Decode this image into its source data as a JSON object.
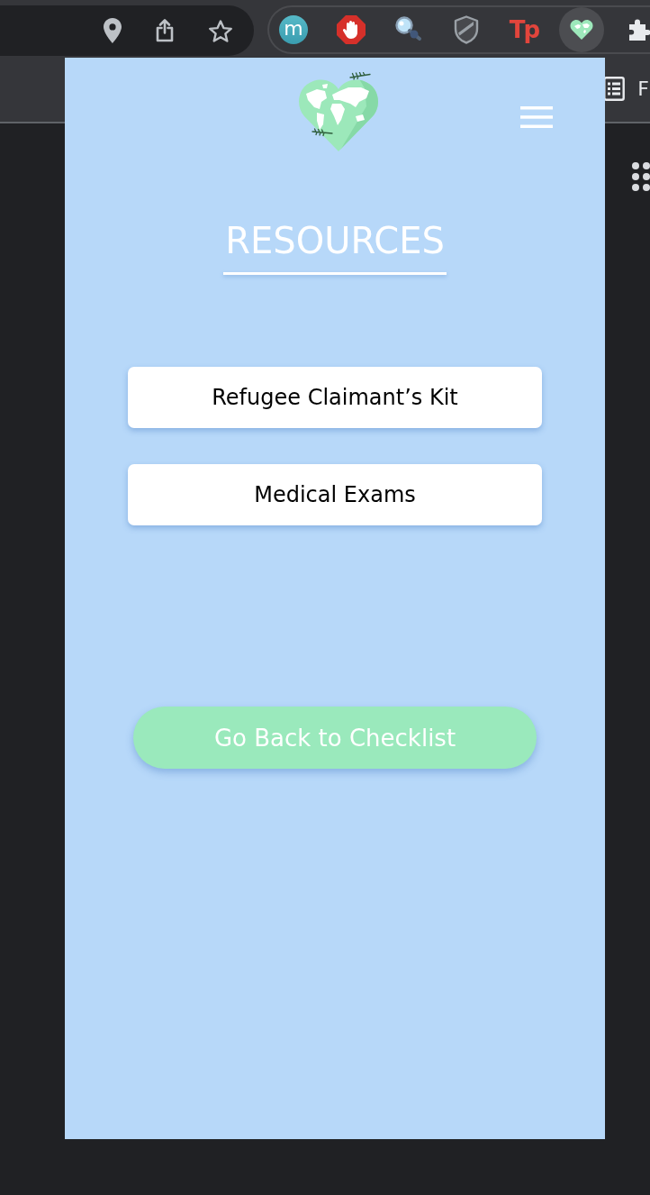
{
  "browser_toolbar": {
    "extensions": [
      {
        "kind": "letter",
        "text": "m",
        "selected": false
      },
      {
        "kind": "stop-hand",
        "selected": false
      },
      {
        "kind": "magnifier",
        "selected": false
      },
      {
        "kind": "shield",
        "selected": false
      },
      {
        "kind": "wordmark",
        "text": "Tp",
        "selected": false
      },
      {
        "kind": "heart",
        "selected": true
      },
      {
        "kind": "puzzle",
        "selected": false
      }
    ]
  },
  "side_button": {
    "label": "F"
  },
  "popup": {
    "title": "RESOURCES",
    "resource_links": [
      {
        "label": "Refugee Claimant’s Kit"
      },
      {
        "label": "Medical Exams"
      }
    ],
    "back_button": {
      "label": "Go Back to Checklist"
    }
  }
}
